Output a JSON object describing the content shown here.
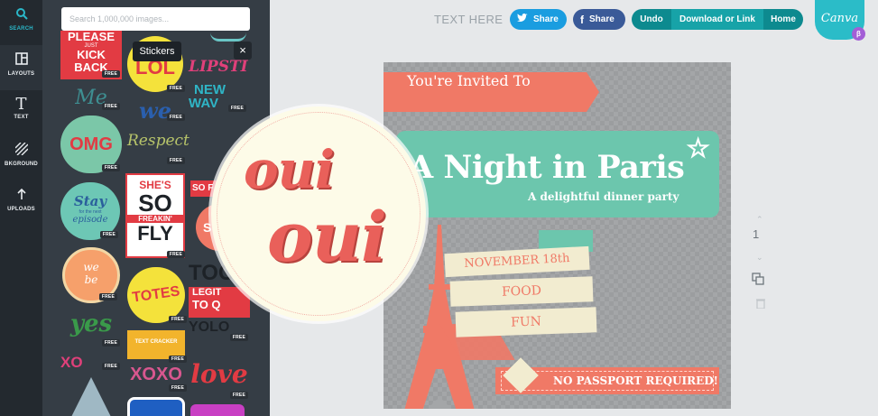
{
  "nav": {
    "search": "SEARCH",
    "layouts": "LAYOUTS",
    "text": "TEXT",
    "background": "BKGROUND",
    "uploads": "UPLOADS"
  },
  "sidebar": {
    "search_placeholder": "Search 1,000,000 images...",
    "tooltip": "Stickers",
    "close": "×",
    "badge": "FREE",
    "stickers": {
      "please": [
        "PLEASE",
        "JUST",
        "KICK BACK"
      ],
      "lol": "LOL",
      "lipstick": "LIPSTI",
      "new_wave": [
        "NEW",
        "WAV"
      ],
      "me": "Me",
      "we": "we",
      "respect": "Respect",
      "omg": "OMG",
      "stay": [
        "Stay",
        "for the next",
        "episode"
      ],
      "shes_so": [
        "SHE'S",
        "SO",
        "FREAKIN'",
        "FLY"
      ],
      "so_fun": "SO F",
      "st": "ST",
      "we_belong": [
        "we",
        "be"
      ],
      "totes": "TOTES",
      "too": "TOO",
      "legit": [
        "LEGIT",
        "TO Q"
      ],
      "yolo": "YOLO",
      "yes": "yes",
      "text_cracker": "TEXT CRACKER",
      "xoxo": "XOXO",
      "love": "love",
      "xo": "XO"
    }
  },
  "header": {
    "text_here": "TEXT HERE",
    "twitter_share": "Share",
    "facebook_share": "Share",
    "undo": "Undo",
    "download": "Download or Link",
    "home": "Home",
    "logo": "Canva",
    "beta": "β"
  },
  "design": {
    "invited": "You're Invited To",
    "title": "A Night in Paris",
    "subtitle": "A delightful dinner party",
    "line1": "NOVEMBER 18th",
    "line2": "FOOD",
    "line3": "FUN",
    "footer": "NO PASSPORT REQUIRED!"
  },
  "preview": {
    "word1": "oui",
    "word2": "oui"
  },
  "page": {
    "number": "1"
  },
  "colors": {
    "accent": "#2ab7c8",
    "coral": "#f07966",
    "mint": "#6cc6ad",
    "cream": "#f2ecd0"
  }
}
